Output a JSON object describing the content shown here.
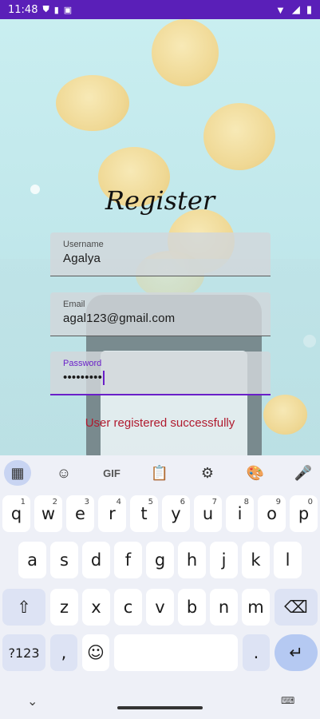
{
  "status": {
    "time": "11:48"
  },
  "title": "Register",
  "fields": {
    "username": {
      "label": "Username",
      "value": "Agalya"
    },
    "email": {
      "label": "Email",
      "value": "agal123@gmail.com"
    },
    "password": {
      "label": "Password",
      "value": "•••••••••"
    }
  },
  "message": "User registered successfully",
  "keyboard": {
    "toolbar": {
      "gif": "GIF"
    },
    "row1": [
      {
        "k": "q",
        "s": "1"
      },
      {
        "k": "w",
        "s": "2"
      },
      {
        "k": "e",
        "s": "3"
      },
      {
        "k": "r",
        "s": "4"
      },
      {
        "k": "t",
        "s": "5"
      },
      {
        "k": "y",
        "s": "6"
      },
      {
        "k": "u",
        "s": "7"
      },
      {
        "k": "i",
        "s": "8"
      },
      {
        "k": "o",
        "s": "9"
      },
      {
        "k": "p",
        "s": "0"
      }
    ],
    "row2": [
      "a",
      "s",
      "d",
      "f",
      "g",
      "h",
      "j",
      "k",
      "l"
    ],
    "row3": [
      "z",
      "x",
      "c",
      "v",
      "b",
      "n",
      "m"
    ],
    "symbols": "?123",
    "comma": ",",
    "period": ".",
    "colors": {
      "accent": "#6a1fc8",
      "success_text": "#b01a2e",
      "statusbar": "#5a1fb8"
    }
  }
}
